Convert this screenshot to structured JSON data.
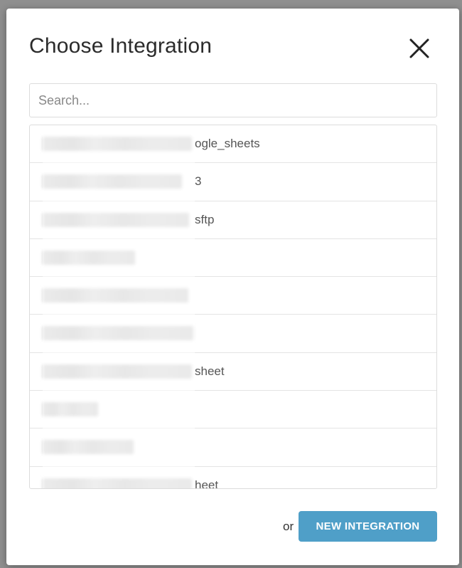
{
  "dialog": {
    "title": "Choose Integration",
    "close_icon": "close-icon"
  },
  "search": {
    "placeholder": "Search...",
    "value": ""
  },
  "integrations": [
    {
      "visible_suffix": "ogle_sheets"
    },
    {
      "visible_suffix": "3"
    },
    {
      "visible_suffix": "sftp"
    },
    {
      "visible_suffix": ""
    },
    {
      "visible_suffix": ""
    },
    {
      "visible_suffix": ""
    },
    {
      "visible_suffix": "sheet"
    },
    {
      "visible_suffix": ""
    },
    {
      "visible_suffix": ""
    },
    {
      "visible_suffix": "heet"
    }
  ],
  "footer": {
    "or_text": "or",
    "new_integration_label": "NEW INTEGRATION"
  },
  "colors": {
    "primary_button": "#4f9fc8",
    "backdrop": "#8f8f8f"
  }
}
